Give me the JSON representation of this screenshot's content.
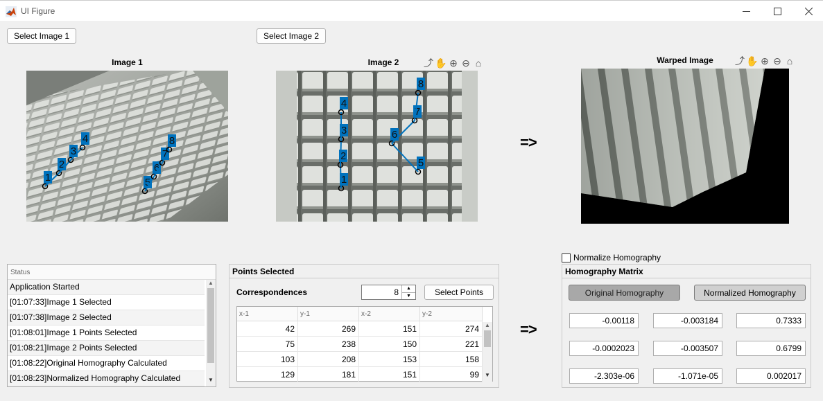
{
  "window": {
    "title": "UI Figure"
  },
  "buttons": {
    "select_image_1": "Select Image 1",
    "select_image_2": "Select Image 2",
    "select_points": "Select Points"
  },
  "image1": {
    "title": "Image 1"
  },
  "image2": {
    "title": "Image 2"
  },
  "warped": {
    "title": "Warped Image"
  },
  "arrow_glyph": "=>",
  "point_labels": [
    "1",
    "2",
    "3",
    "4",
    "5",
    "6",
    "7",
    "8"
  ],
  "status": {
    "header": "Status",
    "rows": [
      "Application Started",
      "[01:07:33]Image 1 Selected",
      "[01:07:38]Image 2 Selected",
      "[01:08:01]Image 1 Points Selected",
      "[01:08:21]Image 2 Points Selected",
      "[01:08:22]Original Homography Calculated",
      "[01:08:23]Normalized Homography Calculated"
    ]
  },
  "points": {
    "title": "Points Selected",
    "correspondences_label": "Correspondences",
    "correspondences_value": "8",
    "columns": [
      "x-1",
      "y-1",
      "x-2",
      "y-2"
    ],
    "rows": [
      [
        "42",
        "269",
        "151",
        "274"
      ],
      [
        "75",
        "238",
        "150",
        "221"
      ],
      [
        "103",
        "208",
        "153",
        "158"
      ],
      [
        "129",
        "181",
        "151",
        "99"
      ]
    ]
  },
  "homography": {
    "normalize_label": "Normalize Homography",
    "normalize_checked": false,
    "title": "Homography Matrix",
    "original_button": "Original Homography",
    "normalized_button": "Normalized Homography",
    "matrix": [
      [
        "-0.00118",
        "-0.003184",
        "0.7333"
      ],
      [
        "-0.0002023",
        "-0.003507",
        "0.6799"
      ],
      [
        "-2.303e-06",
        "-1.071e-05",
        "0.002017"
      ]
    ]
  },
  "colors": {
    "marker": "#0072bd",
    "selected_button": "#a8a8a8"
  }
}
